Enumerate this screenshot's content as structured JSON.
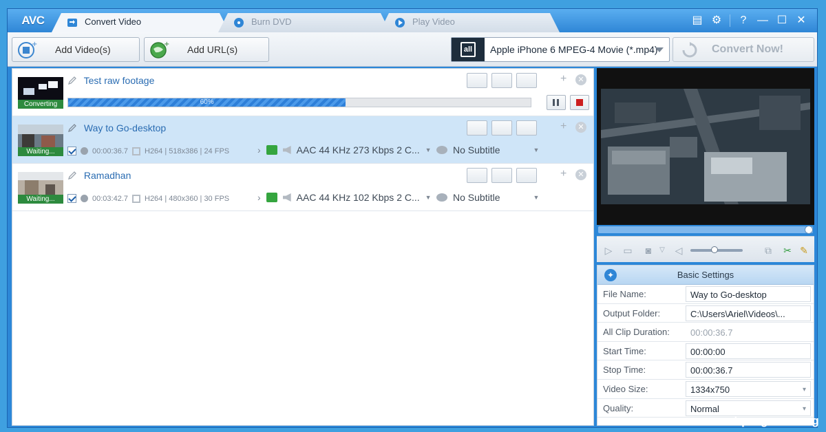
{
  "app": {
    "logo": "AVC"
  },
  "tabs": [
    {
      "label": "Convert Video",
      "active": true
    },
    {
      "label": "Burn DVD",
      "active": false
    },
    {
      "label": "Play Video",
      "active": false
    }
  ],
  "toolbar": {
    "add_videos_label": "Add Video(s)",
    "add_url_label": "Add URL(s)",
    "profile_badge": "all",
    "profile_value": "Apple iPhone 6 MPEG-4 Movie (*.mp4)",
    "convert_label": "Convert Now!"
  },
  "files": [
    {
      "title": "Test raw footage",
      "status": "Converting",
      "progress_text": "60%",
      "progress": 0.6
    },
    {
      "title": "Way to Go-desktop",
      "status": "Waiting...",
      "duration": "00:00:36.7",
      "video_info": "H264 | 518x386 | 24 FPS",
      "audio": "AAC 44 KHz 273 Kbps 2 C...",
      "subtitle": "No Subtitle",
      "selected": true
    },
    {
      "title": "Ramadhan",
      "status": "Waiting...",
      "duration": "00:03:42.7",
      "video_info": "H264 | 480x360 | 30 FPS",
      "audio": "AAC 44 KHz 102 Kbps 2 C...",
      "subtitle": "No Subtitle",
      "selected": false
    }
  ],
  "settings": {
    "header": "Basic Settings",
    "rows": [
      {
        "key": "File Name:",
        "value": "Way to Go-desktop"
      },
      {
        "key": "Output Folder:",
        "value": "C:\\Users\\Ariel\\Videos\\..."
      },
      {
        "key": "All Clip Duration:",
        "value": "00:00:36.7"
      },
      {
        "key": "Start Time:",
        "value": "00:00:00"
      },
      {
        "key": "Stop Time:",
        "value": "00:00:36.7"
      },
      {
        "key": "Video Size:",
        "value": "1334x750"
      },
      {
        "key": "Quality:",
        "value": "Normal"
      }
    ]
  },
  "watermark": "arabprograms.org",
  "colors": {
    "accent": "#2f86d6",
    "selected_row": "#cfe5f8",
    "status_green": "#2d8a3e",
    "stop_red": "#cc1f1f"
  }
}
